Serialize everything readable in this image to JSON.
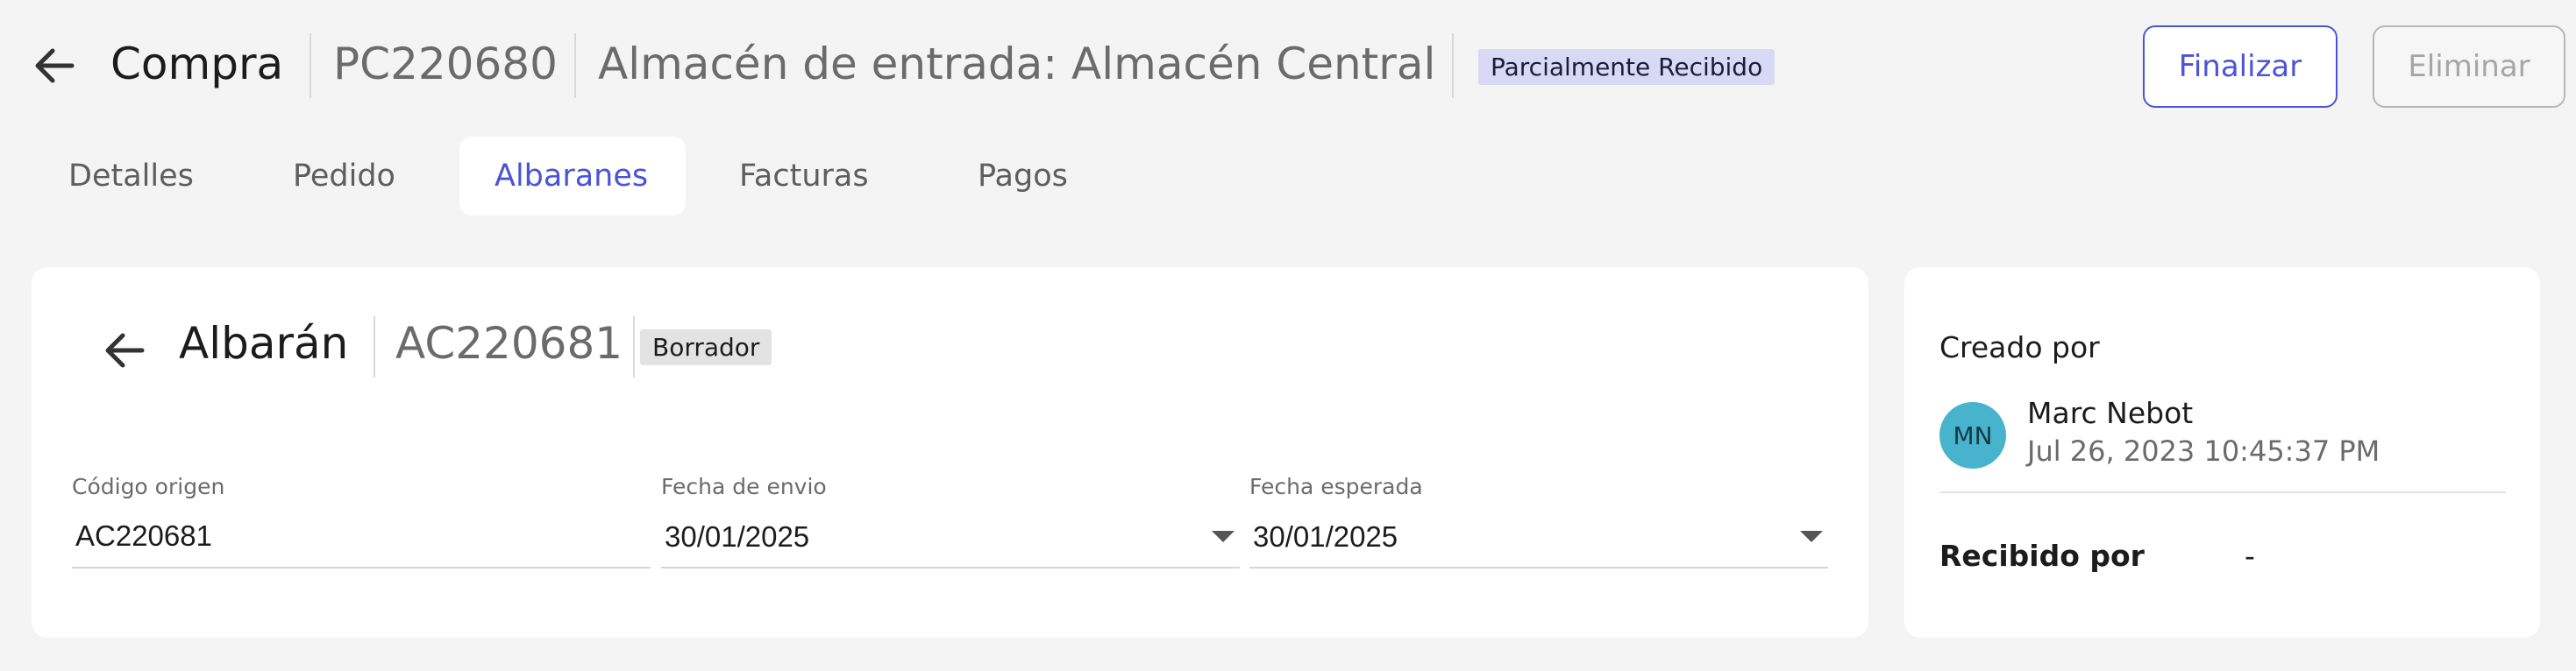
{
  "header": {
    "title": "Compra",
    "code": "PC220680",
    "warehouse": "Almacén de entrada: Almacén Central",
    "status": "Parcialmente Recibido",
    "finalize_label": "Finalizar",
    "delete_label": "Eliminar"
  },
  "tabs": [
    {
      "label": "Detalles"
    },
    {
      "label": "Pedido"
    },
    {
      "label": "Albaranes",
      "active": true
    },
    {
      "label": "Facturas"
    },
    {
      "label": "Pagos"
    }
  ],
  "albaran": {
    "title": "Albarán",
    "code": "AC220681",
    "status": "Borrador",
    "fields": {
      "origin_code": {
        "label": "Código origen",
        "value": "AC220681"
      },
      "ship_date": {
        "label": "Fecha de envio",
        "value": "30/01/2025"
      },
      "expected_date": {
        "label": "Fecha esperada",
        "value": "30/01/2025"
      }
    }
  },
  "sidebar": {
    "created_by_label": "Creado por",
    "creator": {
      "initials": "MN",
      "name": "Marc Nebot",
      "date": "Jul 26, 2023 10:45:37 PM"
    },
    "received_by_label": "Recibido por",
    "received_by_value": "-"
  },
  "colors": {
    "accent": "#4b54d6",
    "status_badge_bg": "#d8d9f5",
    "draft_badge_bg": "#e3e3e3",
    "avatar_bg": "#47b3cc",
    "page_bg": "#f4f4f4"
  }
}
